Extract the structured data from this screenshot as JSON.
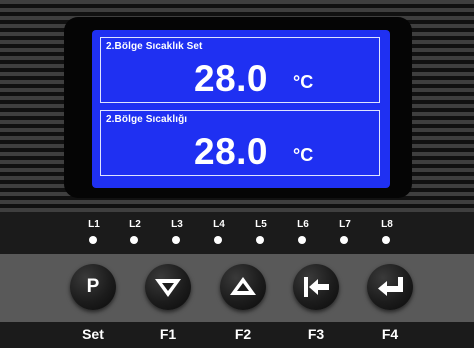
{
  "display": {
    "top_panel": {
      "label": "2.Bölge Sıcaklık Set",
      "value": "28.0",
      "unit": "°C"
    },
    "bottom_panel": {
      "label": "2.Bölge Sıcaklığı",
      "value": "28.0",
      "unit": "°C"
    },
    "background_color": "#1f30f2"
  },
  "leds": [
    "L1",
    "L2",
    "L3",
    "L4",
    "L5",
    "L6",
    "L7",
    "L8"
  ],
  "keys": [
    {
      "glyph": "P",
      "icon": "p-letter",
      "label": "Set"
    },
    {
      "icon": "double-chevron-down-icon",
      "label": "F1"
    },
    {
      "icon": "double-chevron-up-icon",
      "label": "F2"
    },
    {
      "icon": "arrow-left-to-bar-icon",
      "label": "F3"
    },
    {
      "icon": "return-enter-icon",
      "label": "F4"
    }
  ]
}
